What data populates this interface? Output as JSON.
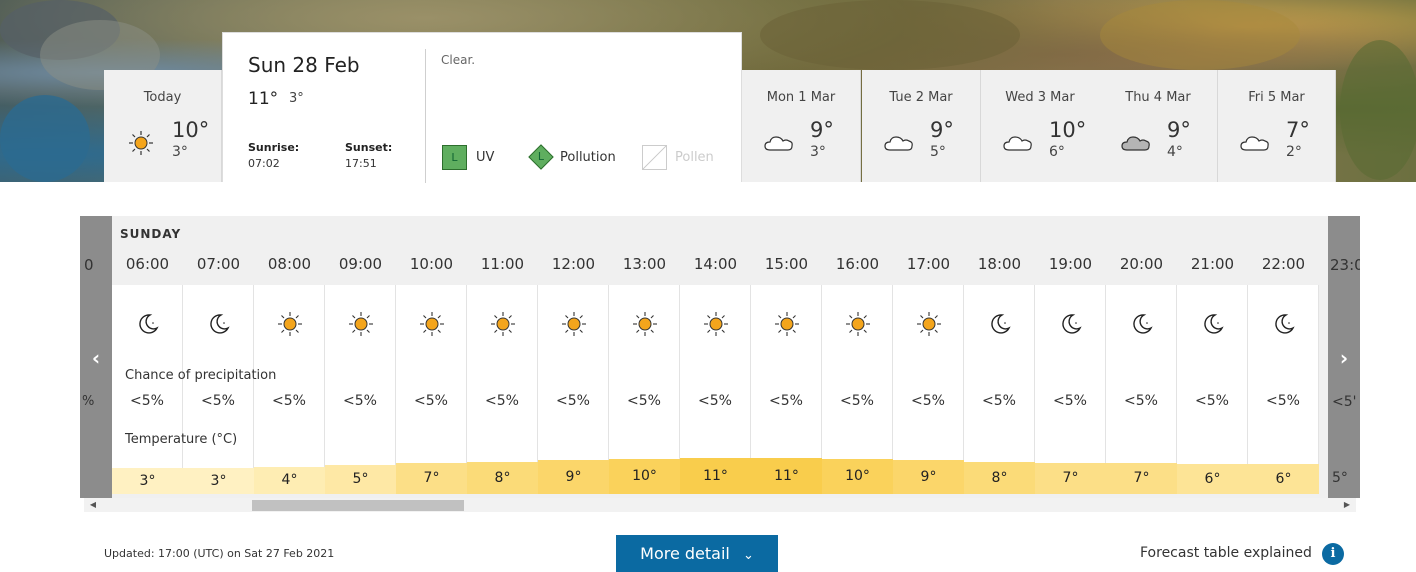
{
  "selected_day": {
    "date": "Sun 28 Feb",
    "high": "11°",
    "low": "3°",
    "sunrise_label": "Sunrise:",
    "sunrise": "07:02",
    "sunset_label": "Sunset:",
    "sunset": "17:51",
    "summary": "Clear.",
    "uv_letter": "L",
    "uv_label": "UV",
    "pollution_letter": "L",
    "pollution_label": "Pollution",
    "pollen_label": "Pollen"
  },
  "today": {
    "label": "Today",
    "high": "10°",
    "low": "3°",
    "icon": "sun-icon"
  },
  "days": [
    {
      "label": "Mon 1 Mar",
      "high": "9°",
      "low": "3°",
      "icon": "cloud-icon"
    },
    {
      "label": "Tue 2 Mar",
      "high": "9°",
      "low": "5°",
      "icon": "cloud-icon"
    },
    {
      "label": "Wed 3 Mar",
      "high": "10°",
      "low": "6°",
      "icon": "cloud-icon"
    },
    {
      "label": "Thu 4 Mar",
      "high": "9°",
      "low": "4°",
      "icon": "grey-cloud-icon"
    },
    {
      "label": "Fri 5 Mar",
      "high": "7°",
      "low": "2°",
      "icon": "cloud-icon"
    }
  ],
  "hourly": {
    "day_label": "SUNDAY",
    "partial_left_time": "0",
    "partial_left_precip": "%",
    "partial_right_time": "23:0",
    "partial_right_precip": "<5'",
    "partial_right_temp": "5°",
    "precip_label": "Chance of precipitation",
    "temp_label": "Temperature (°C)",
    "hours": [
      {
        "time": "06:00",
        "icon": "moon",
        "precip": "<5%",
        "temp": "3°",
        "temp_value": 3
      },
      {
        "time": "07:00",
        "icon": "moon",
        "precip": "<5%",
        "temp": "3°",
        "temp_value": 3
      },
      {
        "time": "08:00",
        "icon": "sun",
        "precip": "<5%",
        "temp": "4°",
        "temp_value": 4
      },
      {
        "time": "09:00",
        "icon": "sun",
        "precip": "<5%",
        "temp": "5°",
        "temp_value": 5
      },
      {
        "time": "10:00",
        "icon": "sun",
        "precip": "<5%",
        "temp": "7°",
        "temp_value": 7
      },
      {
        "time": "11:00",
        "icon": "sun",
        "precip": "<5%",
        "temp": "8°",
        "temp_value": 8
      },
      {
        "time": "12:00",
        "icon": "sun",
        "precip": "<5%",
        "temp": "9°",
        "temp_value": 9
      },
      {
        "time": "13:00",
        "icon": "sun",
        "precip": "<5%",
        "temp": "10°",
        "temp_value": 10
      },
      {
        "time": "14:00",
        "icon": "sun",
        "precip": "<5%",
        "temp": "11°",
        "temp_value": 11
      },
      {
        "time": "15:00",
        "icon": "sun",
        "precip": "<5%",
        "temp": "11°",
        "temp_value": 11
      },
      {
        "time": "16:00",
        "icon": "sun",
        "precip": "<5%",
        "temp": "10°",
        "temp_value": 10
      },
      {
        "time": "17:00",
        "icon": "sun",
        "precip": "<5%",
        "temp": "9°",
        "temp_value": 9
      },
      {
        "time": "18:00",
        "icon": "moon",
        "precip": "<5%",
        "temp": "8°",
        "temp_value": 8
      },
      {
        "time": "19:00",
        "icon": "moon",
        "precip": "<5%",
        "temp": "7°",
        "temp_value": 7
      },
      {
        "time": "20:00",
        "icon": "moon",
        "precip": "<5%",
        "temp": "7°",
        "temp_value": 7
      },
      {
        "time": "21:00",
        "icon": "moon",
        "precip": "<5%",
        "temp": "6°",
        "temp_value": 6
      },
      {
        "time": "22:00",
        "icon": "moon",
        "precip": "<5%",
        "temp": "6°",
        "temp_value": 6
      }
    ]
  },
  "footer": {
    "updated": "Updated: 17:00 (UTC) on Sat 27 Feb 2021",
    "more_detail": "More detail",
    "explained": "Forecast table explained",
    "info_glyph": "i"
  },
  "colors": {
    "accent": "#0b6aa2",
    "sun": "#f4a51c",
    "temp_light": "#fff1c2",
    "temp_dark": "#f9cd4c",
    "uv_green": "#5fae5f"
  }
}
